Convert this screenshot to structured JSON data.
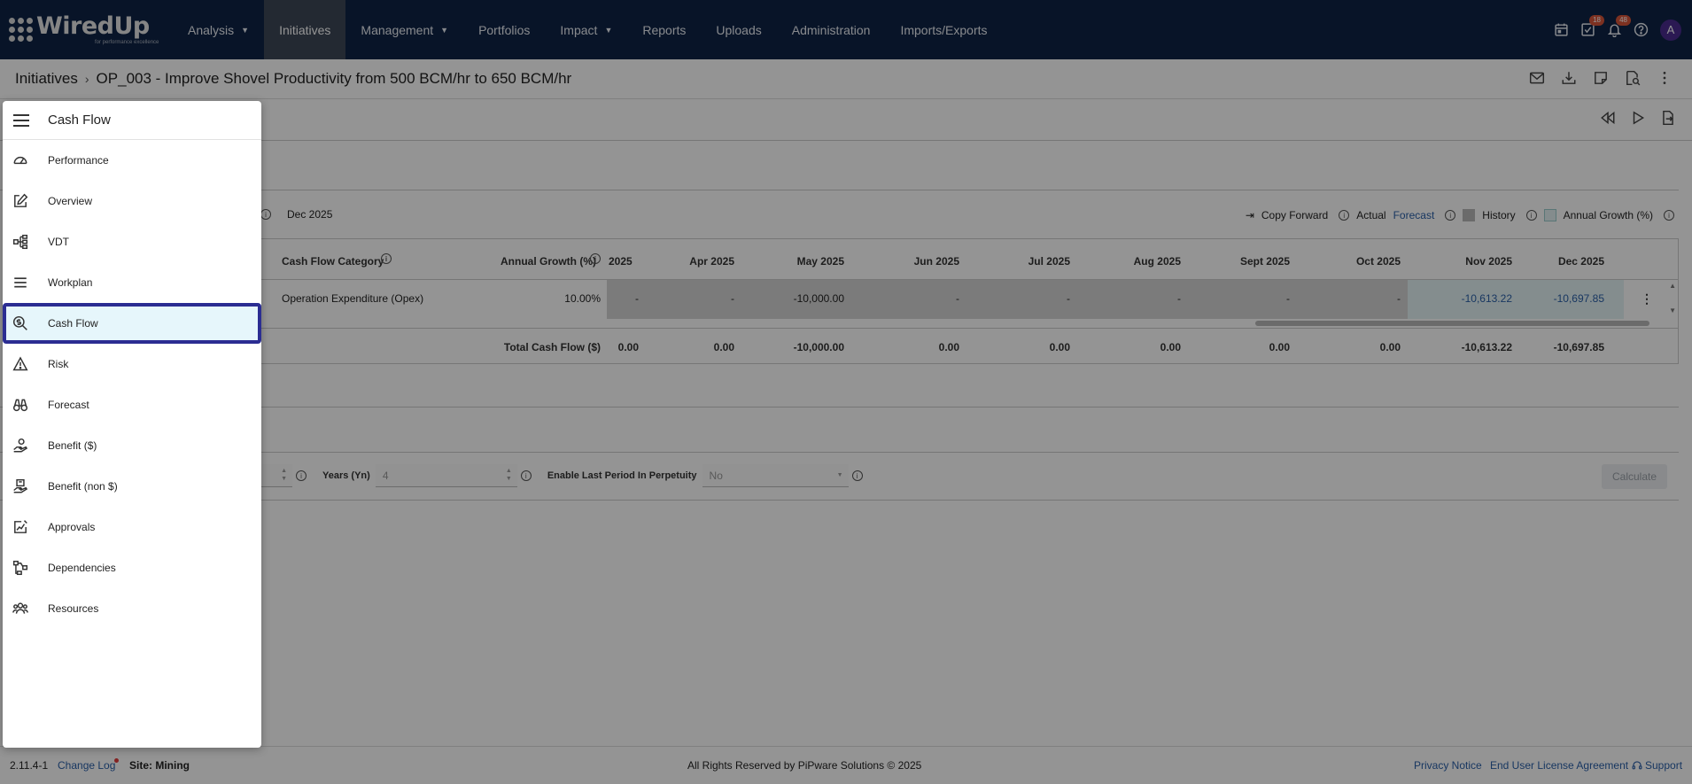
{
  "nav": {
    "logo_word": "WiredUp",
    "logo_tagline": "for performance excellence",
    "items": [
      {
        "label": "Analysis",
        "dropdown": true
      },
      {
        "label": "Initiatives",
        "dropdown": false,
        "active": true
      },
      {
        "label": "Management",
        "dropdown": true
      },
      {
        "label": "Portfolios",
        "dropdown": false
      },
      {
        "label": "Impact",
        "dropdown": true
      },
      {
        "label": "Reports",
        "dropdown": false
      },
      {
        "label": "Uploads",
        "dropdown": false
      },
      {
        "label": "Administration",
        "dropdown": false
      },
      {
        "label": "Imports/Exports",
        "dropdown": false
      }
    ],
    "tasks_badge": "18",
    "notifications_badge": "48",
    "avatar_letter": "A",
    "avatar_color": "#4a2c8f",
    "bar_color": "#0f2445"
  },
  "breadcrumb": {
    "root": "Initiatives",
    "title": "OP_003 - Improve Shovel Productivity from 500 BCM/hr to 650 BCM/hr"
  },
  "cashflow": {
    "period_end_label": "Dec 2025",
    "legend": {
      "copy_forward": "Copy Forward",
      "actual": "Actual",
      "forecast": "Forecast",
      "history": "History",
      "annual_growth": "Annual Growth (%)"
    },
    "headers": {
      "category": "Cash Flow Category",
      "annual_growth": "Annual Growth (%)",
      "months": [
        "2025",
        "Apr 2025",
        "May 2025",
        "Jun 2025",
        "Jul 2025",
        "Aug 2025",
        "Sept 2025",
        "Oct 2025",
        "Nov 2025",
        "Dec 2025"
      ]
    },
    "row": {
      "category": "Operation Expenditure (Opex)",
      "growth": "10.00%",
      "values": [
        "-",
        "-",
        "-10,000.00",
        "-",
        "-",
        "-",
        "-",
        "-",
        "-10,613.22",
        "-10,697.85"
      ]
    },
    "total": {
      "label": "Total Cash Flow ($)",
      "values": [
        "0.00",
        "0.00",
        "-10,000.00",
        "0.00",
        "0.00",
        "0.00",
        "0.00",
        "0.00",
        "-10,613.22",
        "-10,697.85"
      ]
    }
  },
  "calc": {
    "years_label": "Years (Yn)",
    "years_value": "4",
    "perpetuity_label": "Enable Last Period In Perpetuity",
    "perpetuity_value": "No",
    "calculate_label": "Calculate"
  },
  "drawer": {
    "title": "Cash Flow",
    "items": [
      {
        "label": "Performance",
        "icon": "speedometer-icon"
      },
      {
        "label": "Overview",
        "icon": "edit-icon"
      },
      {
        "label": "VDT",
        "icon": "tree-icon"
      },
      {
        "label": "Workplan",
        "icon": "lines-icon"
      },
      {
        "label": "Cash Flow",
        "icon": "search-dollar-icon",
        "selected": true
      },
      {
        "label": "Risk",
        "icon": "warning-icon"
      },
      {
        "label": "Forecast",
        "icon": "binoculars-icon"
      },
      {
        "label": "Benefit ($)",
        "icon": "hand-coin-icon"
      },
      {
        "label": "Benefit (non $)",
        "icon": "hand-box-icon"
      },
      {
        "label": "Approvals",
        "icon": "approval-icon"
      },
      {
        "label": "Dependencies",
        "icon": "network-icon"
      },
      {
        "label": "Resources",
        "icon": "people-icon"
      }
    ]
  },
  "footer": {
    "version": "2.11.4-1",
    "changelog": "Change Log",
    "site": "Site: Mining",
    "rights": "All Rights Reserved by PiPware Solutions © 2025",
    "privacy": "Privacy Notice",
    "eula": "End User License Agreement",
    "support": "Support"
  }
}
